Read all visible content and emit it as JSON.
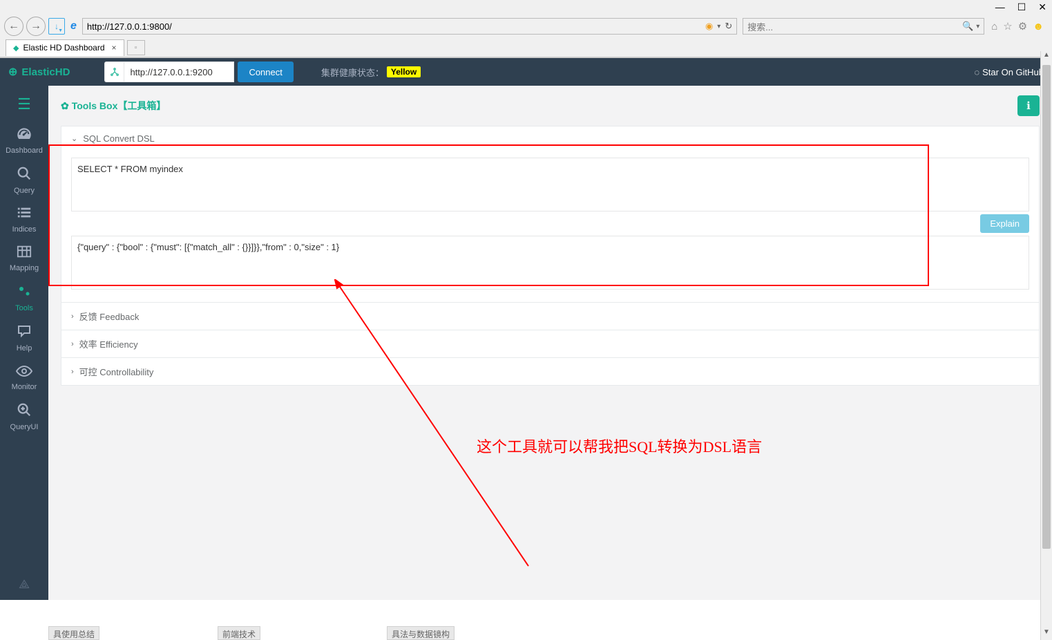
{
  "window": {
    "minimize": "—",
    "maximize": "☐",
    "close": "✕"
  },
  "browser": {
    "url": "http://127.0.0.1:9800/",
    "refresh_glyph": "↻",
    "search_placeholder": "搜索...",
    "tab_title": "Elastic HD Dashboard"
  },
  "topbar": {
    "brand": "ElasticHD",
    "conn_url": "http://127.0.0.1:9200",
    "connect_label": "Connect",
    "cluster_label": "集群健康状态：",
    "cluster_status": "Yellow",
    "github_label": "Star On GitHub"
  },
  "sidebar": {
    "items": [
      {
        "icon": "dashboard",
        "label": "Dashboard"
      },
      {
        "icon": "search",
        "label": "Query"
      },
      {
        "icon": "list",
        "label": "Indices"
      },
      {
        "icon": "table",
        "label": "Mapping"
      },
      {
        "icon": "cogs",
        "label": "Tools"
      },
      {
        "icon": "help",
        "label": "Help"
      },
      {
        "icon": "eye",
        "label": "Monitor"
      },
      {
        "icon": "searchplus",
        "label": "QueryUI"
      }
    ]
  },
  "page": {
    "title": "Tools Box【工具箱】",
    "sections": {
      "sql": {
        "header": "SQL Convert DSL",
        "sql_value": "SELECT * FROM myindex",
        "explain_label": "Explain",
        "dsl_value": "{\"query\" : {\"bool\" : {\"must\": [{\"match_all\" : {}}]}},\"from\" : 0,\"size\" : 1}"
      },
      "feedback": "反馈 Feedback",
      "efficiency": "效率 Efficiency",
      "controllability": "可控 Controllability"
    }
  },
  "annotation": {
    "text": "这个工具就可以帮我把SQL转换为DSL语言"
  },
  "frags": {
    "a": "具使用总结",
    "b": "前端技术",
    "c": "具法与数据镜构"
  }
}
